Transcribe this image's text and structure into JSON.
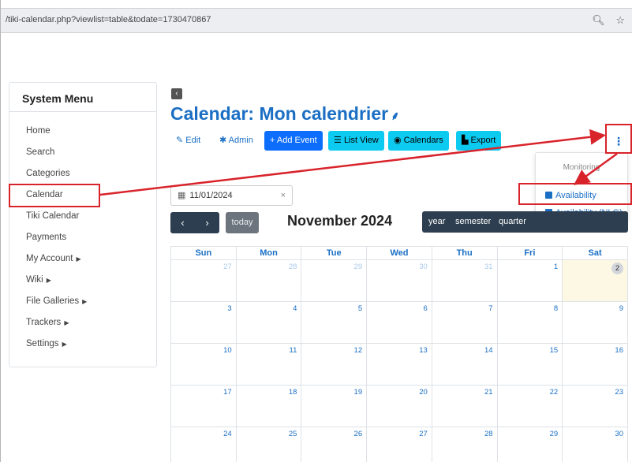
{
  "browser": {
    "url": "/tiki-calendar.php?viewlist=table&todate=1730470867",
    "icons": [
      "zoom-icon",
      "star-icon"
    ]
  },
  "sidebar": {
    "title": "System Menu",
    "items": [
      {
        "label": "Home",
        "submenu": false
      },
      {
        "label": "Search",
        "submenu": false
      },
      {
        "label": "Categories",
        "submenu": false
      },
      {
        "label": "Calendar",
        "submenu": false
      },
      {
        "label": "Tiki Calendar",
        "submenu": false
      },
      {
        "label": "Payments",
        "submenu": false
      },
      {
        "label": "My Account",
        "submenu": true
      },
      {
        "label": "Wiki",
        "submenu": true
      },
      {
        "label": "File Galleries",
        "submenu": true
      },
      {
        "label": "Trackers",
        "submenu": true
      },
      {
        "label": "Settings",
        "submenu": true
      }
    ]
  },
  "page": {
    "title": "Calendar: Mon calendrier"
  },
  "toolbar": {
    "edit": "Edit",
    "admin": "Admin",
    "add_event": "+ Add Event",
    "list_view": "List View",
    "calendars": "Calendars",
    "export": "Export"
  },
  "dropdown": {
    "header": "Monitoring",
    "items": [
      "Availability",
      "Availability (NLG)"
    ]
  },
  "filter": {
    "date": "11/01/2024",
    "clear": "×"
  },
  "calendar": {
    "today_button": "today",
    "month_title": "November 2024",
    "views": [
      "year",
      "semester",
      "quarter"
    ],
    "weekdays": [
      "Sun",
      "Mon",
      "Tue",
      "Wed",
      "Thu",
      "Fri",
      "Sat"
    ],
    "weeks": [
      [
        "27",
        "28",
        "29",
        "30",
        "31",
        "1",
        "2"
      ],
      [
        "3",
        "4",
        "5",
        "6",
        "7",
        "8",
        "9"
      ],
      [
        "10",
        "11",
        "12",
        "13",
        "14",
        "15",
        "16"
      ],
      [
        "17",
        "18",
        "19",
        "20",
        "21",
        "22",
        "23"
      ],
      [
        "24",
        "25",
        "26",
        "27",
        "28",
        "29",
        "30"
      ]
    ],
    "other_month_cells": 5,
    "today_label": "2"
  },
  "colors": {
    "link": "#1a6fc4",
    "primary": "#0d6efd",
    "info": "#0dcaf0",
    "nav_dark": "#2c3e50",
    "highlight": "#d9232b",
    "today_bg": "#fcf8e3"
  }
}
